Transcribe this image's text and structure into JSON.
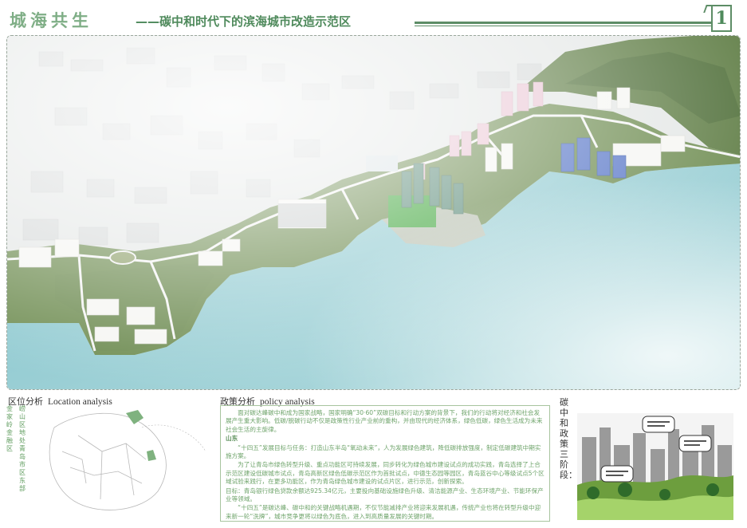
{
  "header": {
    "title": "城海共生",
    "subtitle": "——碳中和时代下的滨海城市改造示范区",
    "page_number": "1"
  },
  "location": {
    "title_cn": "区位分析",
    "title_en": "Location analysis",
    "vertical_col1": "金家岭金融区",
    "vertical_col2": "崂山区地处青岛市区东部"
  },
  "policy": {
    "title_cn": "政策分析",
    "title_en": "policy analysis",
    "paragraphs": [
      "　　面对碳达峰碳中和成为国家战略，国家明确“30·60”双碳目标和行动方案的背景下，我们的行动将对经济和社会发展产生重大影响。低碳/脱碳行动不仅是政策性行业产业前的重构，并由现代的经济体系，绿色低碳，绿色生活成为未来社会生活的主旋律。",
      "山东",
      "　　“十四五”发展目标与任务：打造山东半岛“氧动未来”，人为发展绿色建筑，降低碳排放强度，制定低碳建筑中期实施方案。",
      "　　为了让青岛市绿色转型升级、重点功能区可持续发展，同步转化为绿色城市建设试点的成功实践，青岛选择了上合示范区建设低碳城市试点，青岛高新区绿色低碳示范区作为首批试点，中德生态园等园区，青岛蓝谷中心等级试点5个区域试验来践行，在更多功能区，作为青岛绿色城市建设的试点片区，进行示范，创新探索。",
      "目标：青岛银行绿色贷款余额达925.34亿元，主要投向基础设施绿色升级、清洁能源产业、生态环境产业、节能环保产业等领域。",
      "　　“十四五”是碳达峰、碳中和的关键战略机遇期，不仅节能减排产业将迎来发展机遇，传统产业也将在转型升级中迎来新一轮“洗牌”，城市竞争更将以绿色为底色，进入到高质量发展的关键时期。"
    ]
  },
  "stage": {
    "vertical_label": "碳中和政策三阶段："
  },
  "colors": {
    "title_green": "#7fae86",
    "accent_green": "#4f8a5c",
    "sea": "#8fc8cf",
    "land": "#6f8d52"
  }
}
